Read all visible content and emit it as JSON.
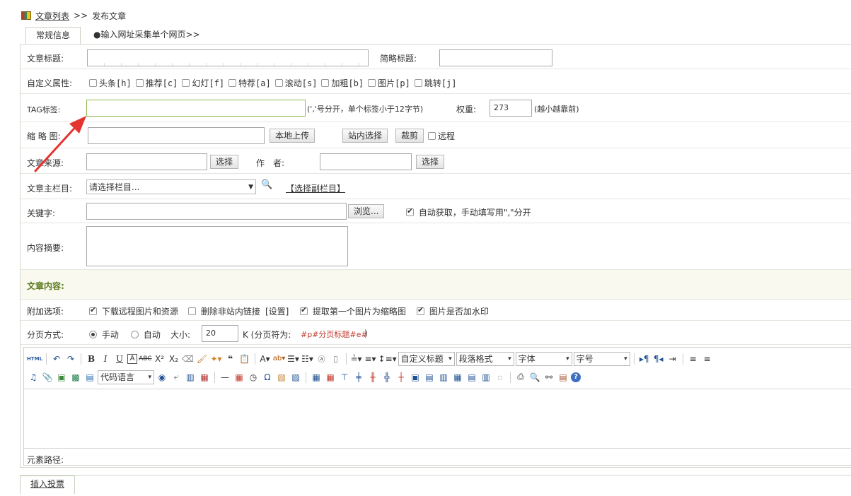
{
  "breadcrumb": {
    "link": "文章列表",
    "sep": ">>",
    "current": "发布文章"
  },
  "tabs": [
    {
      "label": "常规信息"
    },
    {
      "label": "●输入网址采集单个网页>>"
    }
  ],
  "form": {
    "title_label": "文章标题:",
    "short_title_label": "简略标题:",
    "attr_label": "自定义属性:",
    "attrs": [
      "头条[h]",
      "推荐[c]",
      "幻灯[f]",
      "特荐[a]",
      "滚动[s]",
      "加粗[b]",
      "图片[p]",
      "跳转[j]"
    ],
    "tag_label": "TAG标签:",
    "tag_hint": "(','号分开，单个标签小于12字节)",
    "weight_label": "权重:",
    "weight_value": "273",
    "weight_hint": "(越小越靠前)",
    "thumb_label": "缩 略 图:",
    "upload_btn": "本地上传",
    "site_select_btn": "站内选择",
    "crop_btn": "裁剪",
    "remote_label": "远程",
    "source_label": "文章来源:",
    "select_btn": "选择",
    "author_label": "作　者:",
    "column_label": "文章主栏目:",
    "column_placeholder": "请选择栏目...",
    "sub_column_link": "【选择副栏目】",
    "keyword_label": "关键字:",
    "browse_btn": "浏览...",
    "auto_keyword_label": "自动获取，手动填写用\",\"分开",
    "summary_label": "内容摘要:",
    "content_section": "文章内容:",
    "options_label": "附加选项:",
    "options": [
      "下载远程图片和资源",
      "删除非站内链接",
      "[设置]",
      "提取第一个图片为缩略图",
      "图片是否加水印"
    ],
    "paging_label": "分页方式:",
    "manual_label": "手动",
    "auto_label": "自动",
    "size_label": "大小:",
    "size_value": "20",
    "size_unit": "K (分页符为:",
    "page_marker": "#p#分页标题#e#",
    "paren_close": ")"
  },
  "editor": {
    "html_label": "HTML",
    "format_select": "自定义标题",
    "para_select": "段落格式",
    "font_select": "字体",
    "size_select": "字号",
    "code_select": "代码语言",
    "path_label": "元素路径:"
  },
  "bottom_tab": "插入投票",
  "colors": {
    "accent": "#5a7a1e",
    "red": "#e3342f",
    "border": "#d2d9cc",
    "section_bg": "#f9f9ef"
  }
}
